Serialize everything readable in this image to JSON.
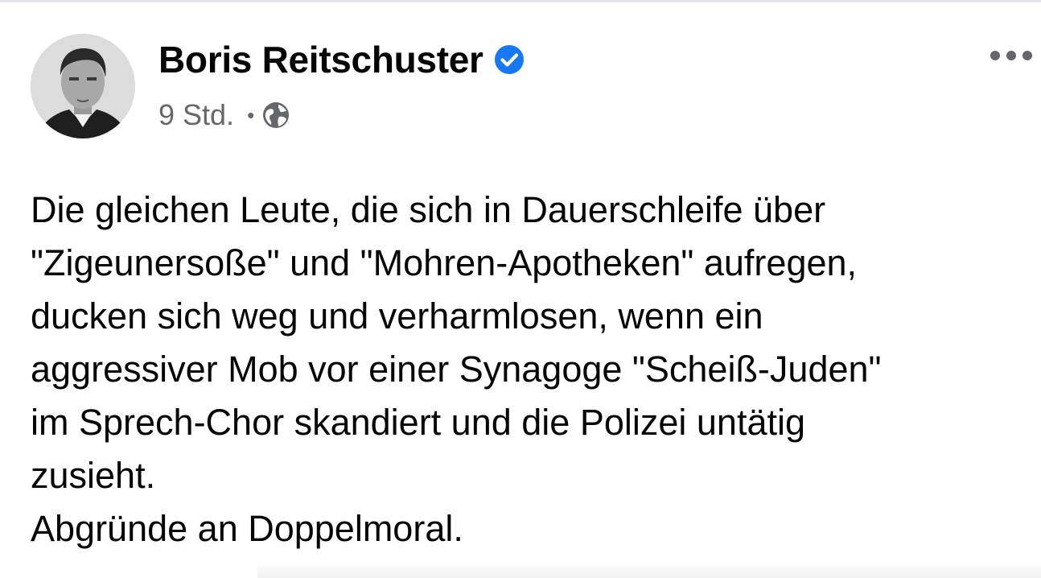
{
  "post": {
    "author": {
      "name": "Boris Reitschuster",
      "verified": true,
      "avatar_icon": "profile-photo"
    },
    "meta": {
      "timestamp": "9 Std.",
      "separator": "•",
      "audience_icon": "globe-icon"
    },
    "menu_icon": "more-options-icon",
    "body_lines": [
      "Die gleichen Leute, die sich in Dauerschleife über",
      "\"Zigeunersoße\" und \"Mohren-Apotheken\" aufregen,",
      "ducken sich weg und verharmlosen, wenn ein",
      "aggressiver Mob vor einer Synagoge \"Scheiß-Juden\"",
      "im Sprech-Chor skandiert und die Polizei untätig",
      "zusieht.",
      "Abgründe an Doppelmoral."
    ]
  },
  "colors": {
    "text_primary": "#050505",
    "text_secondary": "#65676b",
    "verified_badge": "#1877f2",
    "background": "#ffffff"
  }
}
